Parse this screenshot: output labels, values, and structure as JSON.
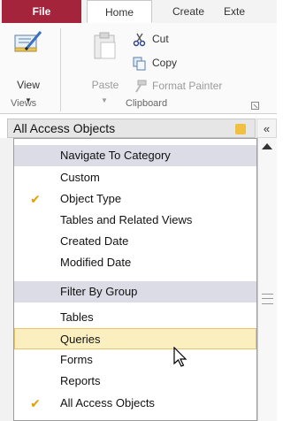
{
  "ribbon": {
    "tabs": [
      "File",
      "Home",
      "Create",
      "Exte"
    ],
    "groups": {
      "views": {
        "label": "Views",
        "view_label": "View"
      },
      "clipboard": {
        "label": "Clipboard",
        "paste_label": "Paste",
        "cut_label": "Cut",
        "copy_label": "Copy",
        "format_painter_label": "Format Painter"
      }
    }
  },
  "nav_pane": {
    "title": "All Access Objects",
    "shutter_glyph": "«"
  },
  "menu": {
    "items": [
      {
        "type": "header",
        "label": "Navigate To Category"
      },
      {
        "type": "item",
        "label": "Custom",
        "checked": false
      },
      {
        "type": "item",
        "label": "Object Type",
        "checked": true
      },
      {
        "type": "item",
        "label": "Tables and Related Views",
        "checked": false
      },
      {
        "type": "item",
        "label": "Created Date",
        "checked": false
      },
      {
        "type": "item",
        "label": "Modified Date",
        "checked": false
      },
      {
        "type": "header",
        "label": "Filter By Group"
      },
      {
        "type": "item",
        "label": "Tables",
        "checked": false
      },
      {
        "type": "item",
        "label": "Queries",
        "checked": false,
        "hover": true
      },
      {
        "type": "item",
        "label": "Forms",
        "checked": false
      },
      {
        "type": "item",
        "label": "Reports",
        "checked": false
      },
      {
        "type": "item",
        "label": "All Access Objects",
        "checked": true
      }
    ]
  },
  "icons": {
    "view": "design-view-icon",
    "paste": "paste-icon",
    "cut": "scissors-icon",
    "copy": "copy-icon",
    "format_painter": "format-painter-icon",
    "dropdown": "chevron-down-icon",
    "checkmark": "checkmark-icon",
    "cursor": "mouse-pointer-icon"
  },
  "colors": {
    "file_tab": "#a4243b",
    "menu_header_bg": "#dcdce6",
    "hover_bg": "#fcefbf",
    "check": "#e0a000"
  }
}
